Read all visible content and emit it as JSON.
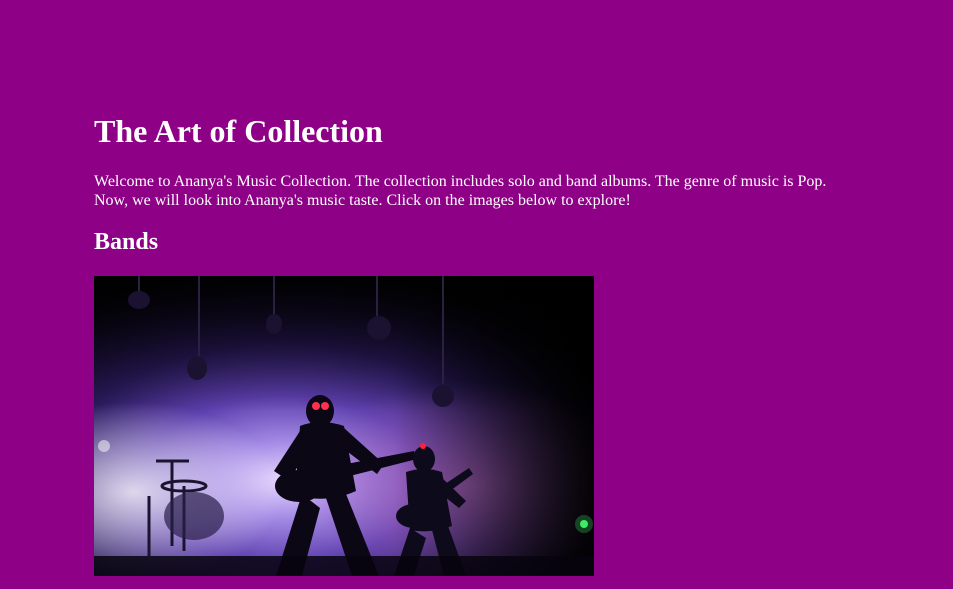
{
  "page": {
    "title": "The Art of Collection",
    "intro": "Welcome to Ananya's Music Collection. The collection includes solo and band albums. The genre of music is Pop. Now, we will look into Ananya's music taste. Click on the images below to explore!",
    "background_color": "#8e0086",
    "text_color": "#ffffff"
  },
  "sections": [
    {
      "heading": "Bands",
      "image": {
        "alt": "Bands",
        "depicts": "concert-photo-icon"
      }
    }
  ]
}
